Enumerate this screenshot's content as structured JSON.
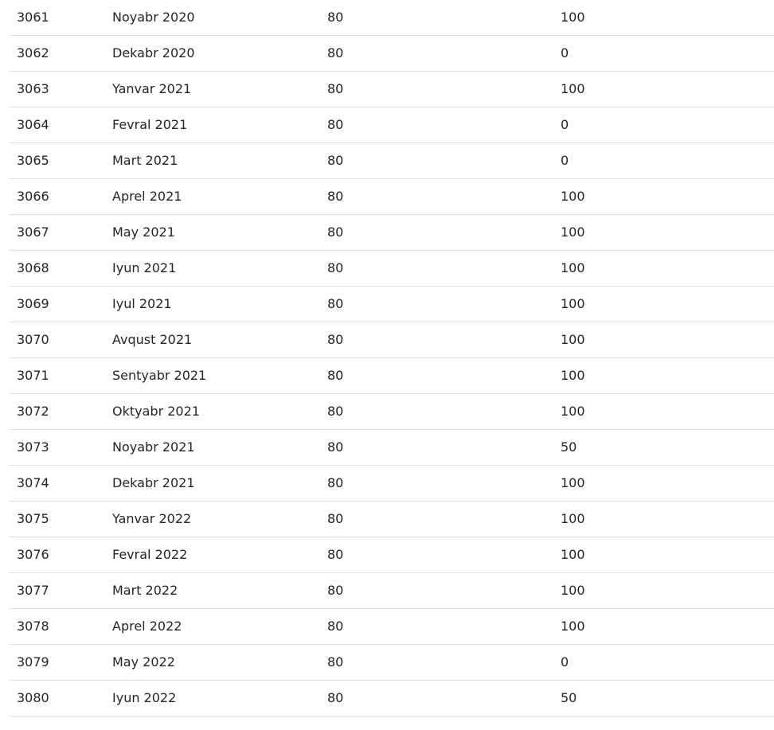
{
  "rows": [
    {
      "id": "3061",
      "period": "Noyabr 2020",
      "value1": "80",
      "value2": "100"
    },
    {
      "id": "3062",
      "period": "Dekabr 2020",
      "value1": "80",
      "value2": "0"
    },
    {
      "id": "3063",
      "period": "Yanvar 2021",
      "value1": "80",
      "value2": "100"
    },
    {
      "id": "3064",
      "period": "Fevral 2021",
      "value1": "80",
      "value2": "0"
    },
    {
      "id": "3065",
      "period": "Mart 2021",
      "value1": "80",
      "value2": "0"
    },
    {
      "id": "3066",
      "period": "Aprel 2021",
      "value1": "80",
      "value2": "100"
    },
    {
      "id": "3067",
      "period": "May 2021",
      "value1": "80",
      "value2": "100"
    },
    {
      "id": "3068",
      "period": "Iyun 2021",
      "value1": "80",
      "value2": "100"
    },
    {
      "id": "3069",
      "period": "Iyul 2021",
      "value1": "80",
      "value2": "100"
    },
    {
      "id": "3070",
      "period": "Avqust 2021",
      "value1": "80",
      "value2": "100"
    },
    {
      "id": "3071",
      "period": "Sentyabr 2021",
      "value1": "80",
      "value2": "100"
    },
    {
      "id": "3072",
      "period": "Oktyabr 2021",
      "value1": "80",
      "value2": "100"
    },
    {
      "id": "3073",
      "period": "Noyabr 2021",
      "value1": "80",
      "value2": "50"
    },
    {
      "id": "3074",
      "period": "Dekabr 2021",
      "value1": "80",
      "value2": "100"
    },
    {
      "id": "3075",
      "period": "Yanvar 2022",
      "value1": "80",
      "value2": "100"
    },
    {
      "id": "3076",
      "period": "Fevral 2022",
      "value1": "80",
      "value2": "100"
    },
    {
      "id": "3077",
      "period": "Mart 2022",
      "value1": "80",
      "value2": "100"
    },
    {
      "id": "3078",
      "period": "Aprel 2022",
      "value1": "80",
      "value2": "100"
    },
    {
      "id": "3079",
      "period": "May 2022",
      "value1": "80",
      "value2": "0"
    },
    {
      "id": "3080",
      "period": "Iyun 2022",
      "value1": "80",
      "value2": "50"
    }
  ],
  "colors": {
    "text": "#212529",
    "row_divider": "#dee2e6",
    "background": "#ffffff"
  }
}
